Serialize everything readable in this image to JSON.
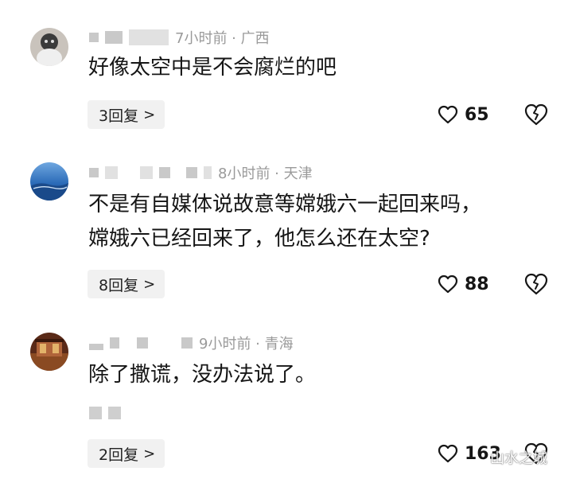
{
  "comments": [
    {
      "meta": "7小时前 · 广西",
      "lines": [
        "好像太空中是不会腐烂的吧"
      ],
      "reply_label": "3回复",
      "likes": "65"
    },
    {
      "meta": "8小时前 · 天津",
      "lines": [
        "不是有自媒体说故意等嫦娥六一起回来吗，",
        "嫦娥六已经回来了，他怎么还在太空?"
      ],
      "reply_label": "8回复",
      "likes": "88"
    },
    {
      "meta": "9小时前 · 青海",
      "lines": [
        "除了撒谎，没办法说了。"
      ],
      "reply_label": "2回复",
      "likes": "163"
    }
  ],
  "reply_chevron": ">",
  "watermark": "山水之城",
  "icons": {
    "like": "heart-outline-icon",
    "dislike": "broken-heart-icon"
  },
  "colors": {
    "text": "#161616",
    "meta": "#9a9a9a",
    "reply_bg": "#f1f1f1"
  }
}
